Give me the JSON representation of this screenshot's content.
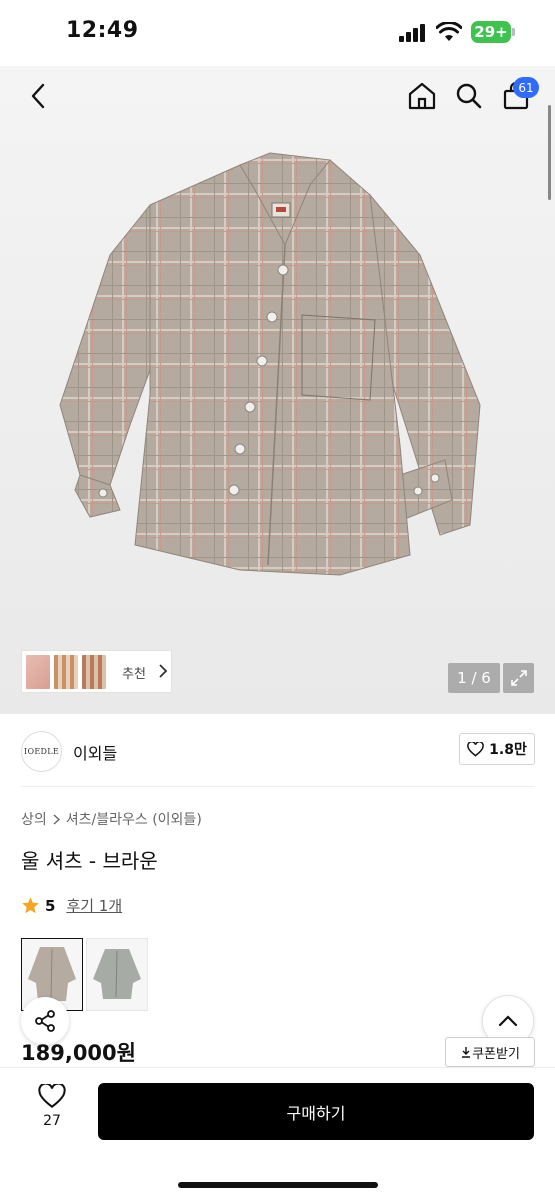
{
  "status": {
    "time": "12:49",
    "battery": "29+"
  },
  "header": {
    "cart_count": "61"
  },
  "gallery": {
    "related_label": "추천",
    "pager": "1 / 6"
  },
  "store": {
    "logo_text": "IOEDLE",
    "name": "이외들",
    "likes": "1.8만"
  },
  "product": {
    "breadcrumb": [
      "상의",
      "셔츠/블라우스 (이외들)"
    ],
    "title": "울 셔츠 - 브라운",
    "rating": "5",
    "reviews": "후기 1개",
    "price": "189,000원",
    "coupon": "쿠폰받기"
  },
  "bottom": {
    "wish_count": "27",
    "buy_label": "구매하기"
  },
  "colors": {
    "accent": "#2f6bff",
    "star": "#f5a623",
    "battery": "#3ec34f"
  },
  "icons": [
    "back-icon",
    "home-icon",
    "search-icon",
    "cart-icon",
    "chevron-right-icon",
    "expand-icon",
    "heart-icon",
    "star-icon",
    "share-icon",
    "chevron-up-icon",
    "download-icon"
  ]
}
